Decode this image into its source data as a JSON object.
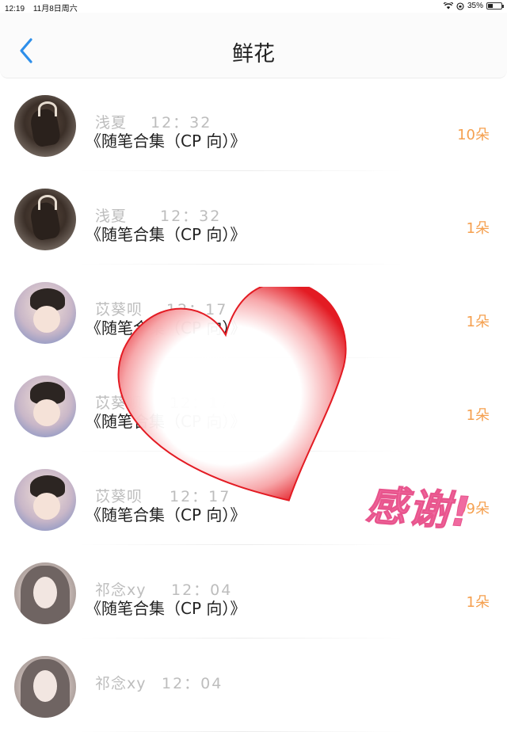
{
  "status_bar": {
    "time": "12:19",
    "date": "11月8日周六",
    "battery": "35%",
    "battery_level": 0.35
  },
  "header": {
    "title": "鲜花",
    "back_icon": "chevron-left-icon"
  },
  "rows": [
    {
      "name": "浅夏",
      "time": "12：32",
      "work": "《随笔合集（CP 向）》",
      "count": "10朵",
      "avatar": "dark"
    },
    {
      "name": "浅夏",
      "time": "12：32",
      "work": "《随笔合集（CP 向）》",
      "count": "1朵",
      "avatar": "dark"
    },
    {
      "name": "苡葵呗",
      "time": "12：17",
      "work": "《随笔合集（CP 向）》",
      "count": "1朵",
      "avatar": "boy"
    },
    {
      "name": "苡葵呗",
      "time": "12：17",
      "work": "《随笔合集（CP 向）》",
      "count": "1朵",
      "avatar": "boy"
    },
    {
      "name": "苡葵呗",
      "time": "12：17",
      "work": "《随笔合集（CP 向）》",
      "count": "99朵",
      "avatar": "boy"
    },
    {
      "name": "祁念xy",
      "time": "12：04",
      "work": "《随笔合集（CP 向）》",
      "count": "1朵",
      "avatar": "girl"
    },
    {
      "name": "祁念xy",
      "time": "12：04",
      "work": "",
      "count": "",
      "avatar": "girl"
    }
  ],
  "overlay": {
    "thanks_text": "感谢!",
    "heart_color": "#e31b23",
    "thanks_color": "#f06aa0"
  },
  "colors": {
    "accent": "#2e8fea",
    "count": "#f5a04f"
  }
}
